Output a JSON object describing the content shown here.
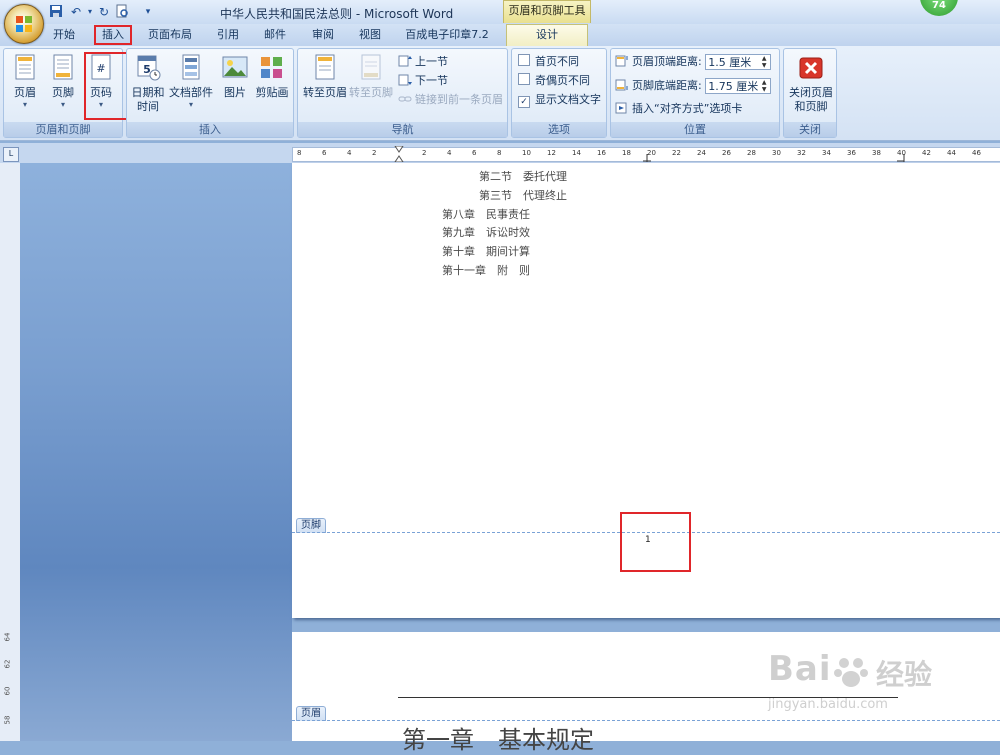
{
  "window": {
    "title": "中华人民共和国民法总则 - Microsoft Word",
    "context_tab_title": "页眉和页脚工具",
    "user_badge": "74"
  },
  "tabs": [
    "开始",
    "插入",
    "页面布局",
    "引用",
    "邮件",
    "审阅",
    "视图",
    "百成电子印章7.2",
    "设计"
  ],
  "ribbon": {
    "group_header_footer": {
      "label": "页眉和页脚",
      "header_btn": "页眉",
      "footer_btn": "页脚",
      "page_number_btn": "页码"
    },
    "group_insert": {
      "label": "插入",
      "date_time_btn_line1": "日期和",
      "date_time_btn_line2": "时间",
      "doc_parts_btn": "文档部件",
      "picture_btn": "图片",
      "clipart_btn": "剪贴画"
    },
    "group_nav": {
      "label": "导航",
      "goto_header_btn": "转至页眉",
      "goto_footer_btn": "转至页脚",
      "prev_section": "上一节",
      "next_section": "下一节",
      "link_to_previous": "链接到前一条页眉"
    },
    "group_options": {
      "label": "选项",
      "diff_first_page": "首页不同",
      "diff_odd_even": "奇偶页不同",
      "show_doc_text": "显示文档文字"
    },
    "group_position": {
      "label": "位置",
      "header_from_top_label": "页眉顶端距离:",
      "header_from_top_value": "1.5 厘米",
      "footer_from_bottom_label": "页脚底端距离:",
      "footer_from_bottom_value": "1.75 厘米",
      "insert_align_tab": "插入“对齐方式”选项卡"
    },
    "group_close": {
      "label": "关闭",
      "close_btn_line1": "关闭页眉",
      "close_btn_line2": "和页脚"
    }
  },
  "ruler_ticks": [
    "8",
    "6",
    "4",
    "2",
    "2",
    "4",
    "6",
    "8",
    "10",
    "12",
    "14",
    "16",
    "18",
    "20",
    "22",
    "24",
    "26",
    "28",
    "30",
    "32",
    "34",
    "36",
    "38",
    "40",
    "42",
    "44",
    "46"
  ],
  "vruler_ticks": [
    "64",
    "62",
    "60",
    "58"
  ],
  "document": {
    "toc_lines": [
      "第二节　委托代理",
      "第三节　代理终止",
      "第八章　民事责任",
      "第九章　诉讼时效",
      "第十章　期间计算",
      "第十一章　附　则"
    ],
    "footer_tag": "页脚",
    "page_number": "1",
    "header_tag": "页眉",
    "chapter_heading": "第一章　基本规定"
  },
  "watermark": {
    "line1": "Bai",
    "line1b": "经验",
    "line2": "jingyan.baidu.com"
  },
  "colors": {
    "highlight_red": "#e0262a",
    "ribbon_bg": "#d4e2f4",
    "design_tab": "#f1eec3"
  }
}
